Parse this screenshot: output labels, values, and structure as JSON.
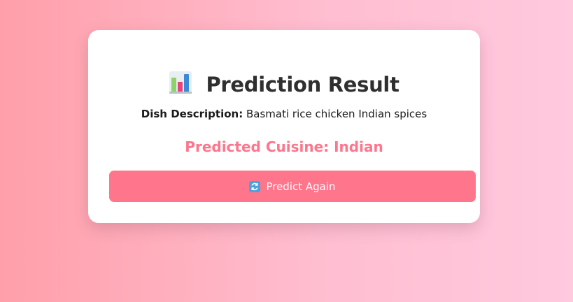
{
  "title": {
    "icon": "bar-chart-icon",
    "text": "Prediction Result"
  },
  "description": {
    "label": "Dish Description:",
    "value": "Basmati rice chicken Indian spices"
  },
  "prediction": {
    "text": "Predicted Cuisine: Indian"
  },
  "button": {
    "icon": "refresh-icon",
    "label": "Predict Again"
  },
  "colors": {
    "accent": "#ff758c",
    "title": "#2f2f2f",
    "card": "#ffffff",
    "bg_left": "#ff9fa9",
    "bg_right": "#ffc9de"
  }
}
